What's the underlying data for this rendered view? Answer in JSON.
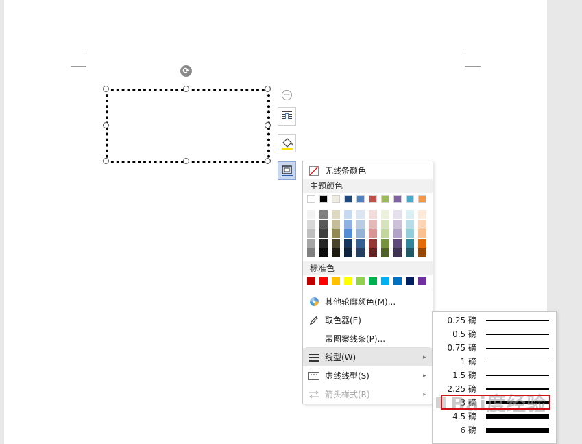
{
  "floating_toolbar": {
    "collapse_symbol": "−",
    "items": [
      "wrap-text-icon",
      "fill-icon",
      "outline-icon"
    ]
  },
  "outline_menu": {
    "no_line_color": "无线条颜色",
    "theme_colors_label": "主题颜色",
    "theme_colors_top": [
      "#ffffff",
      "#000000",
      "#eeece1",
      "#1f497d",
      "#4f81bd",
      "#c0504d",
      "#9bbb59",
      "#8064a2",
      "#4bacc6",
      "#f79646"
    ],
    "theme_shades": [
      [
        "#f2f2f2",
        "#7f7f7f",
        "#ddd9c3",
        "#c6d9f0",
        "#dbe5f1",
        "#f2dcdb",
        "#ebf1dd",
        "#e5e0ec",
        "#dbeef3",
        "#fdeada"
      ],
      [
        "#d8d8d8",
        "#595959",
        "#c4bd97",
        "#8db3e2",
        "#b8cce4",
        "#e5b9b7",
        "#d7e3bc",
        "#ccc1d9",
        "#b7dde8",
        "#fbd5b5"
      ],
      [
        "#bfbfbf",
        "#3f3f3f",
        "#938953",
        "#548dd4",
        "#95b3d7",
        "#d99694",
        "#c3d69b",
        "#b2a2c7",
        "#92cddc",
        "#fac08f"
      ],
      [
        "#a5a5a5",
        "#262626",
        "#494429",
        "#17365d",
        "#366092",
        "#953734",
        "#76923c",
        "#5f497a",
        "#31859b",
        "#e36c09"
      ],
      [
        "#7f7f7f",
        "#0c0c0c",
        "#1d1b10",
        "#0f243e",
        "#244061",
        "#632423",
        "#4f6128",
        "#3f3151",
        "#205867",
        "#974806"
      ]
    ],
    "standard_colors_label": "标准色",
    "standard_colors": [
      "#c00000",
      "#ff0000",
      "#ffc000",
      "#ffff00",
      "#92d050",
      "#00b050",
      "#00b0f0",
      "#0070c0",
      "#002060",
      "#7030a0"
    ],
    "more_colors": "其他轮廓颜色(M)...",
    "eyedropper": "取色器(E)",
    "pattern_lines": "带图案线条(P)...",
    "line_style": "线型(W)",
    "dash_style": "虚线线型(S)",
    "arrow_style": "箭头样式(R)"
  },
  "line_weight_menu": {
    "items": [
      {
        "label": "0.25 磅",
        "weight": 0.25
      },
      {
        "label": "0.5 磅",
        "weight": 0.5
      },
      {
        "label": "0.75 磅",
        "weight": 0.75
      },
      {
        "label": "1 磅",
        "weight": 1
      },
      {
        "label": "1.5 磅",
        "weight": 1.5
      },
      {
        "label": "2.25 磅",
        "weight": 2.25
      },
      {
        "label": "3 磅",
        "weight": 3
      },
      {
        "label": "4.5 磅",
        "weight": 4.5
      },
      {
        "label": "6 磅",
        "weight": 6
      }
    ],
    "selected_label": "3 磅"
  },
  "watermark": "Bai度经验"
}
